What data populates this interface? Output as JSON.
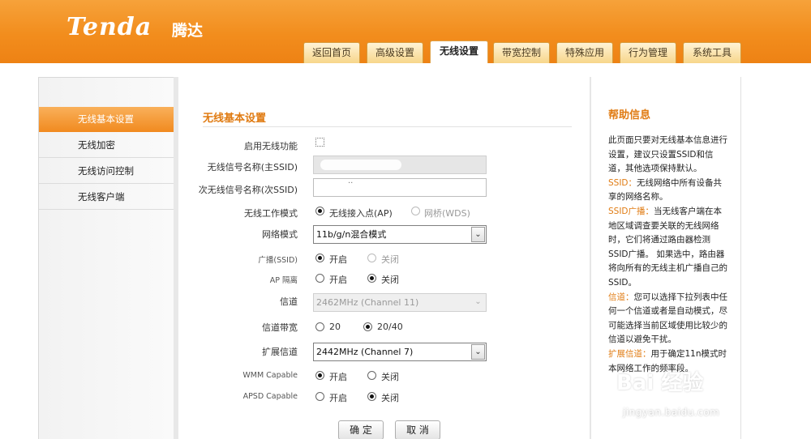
{
  "header": {
    "logo_text": "Tenda",
    "logo_cn": "腾达",
    "tabs": [
      "返回首页",
      "高级设置",
      "无线设置",
      "带宽控制",
      "特殊应用",
      "行为管理",
      "系统工具"
    ],
    "active_tab": "无线设置",
    "accent_color": "#f28d1d"
  },
  "sidebar": {
    "items": [
      "无线基本设置",
      "无线加密",
      "无线访问控制",
      "无线客户端"
    ],
    "active": "无线基本设置"
  },
  "form": {
    "title": "无线基本设置",
    "enable_wireless_label": "启用无线功能",
    "ssid_label": "无线信号名称(主SSID)",
    "ssid2_label": "次无线信号名称(次SSID)",
    "ssid2_value": "··",
    "mode_label": "无线工作模式",
    "mode_options": [
      "无线接入点(AP)",
      "网桥(WDS)"
    ],
    "network_mode_label": "网络模式",
    "network_mode_value": "11b/g/n混合模式",
    "broadcast_label": "广播(SSID)",
    "on": "开启",
    "off": "关闭",
    "ap_isolation_label": "AP 隔离",
    "channel_label": "信道",
    "channel_value": "2462MHz (Channel 11)",
    "bandwidth_label": "信道带宽",
    "bandwidth_options": [
      "20",
      "20/40"
    ],
    "ext_channel_label": "扩展信道",
    "ext_channel_value": "2442MHz (Channel 7)",
    "wmm_label": "WMM Capable",
    "apsd_label": "APSD Capable",
    "ok_button": "确 定",
    "cancel_button": "取 消"
  },
  "help": {
    "title": "帮助信息",
    "intro": "此页面只要对无线基本信息进行设置，建议只设置SSID和信道，其他选项保持默认。",
    "ssid_term": "SSID：",
    "ssid_text": "无线网络中所有设备共享的网络名称。",
    "bcast_term": "SSID广播：",
    "bcast_text": "当无线客户端在本地区域调查要关联的无线网络时，它们将通过路由器检测SSID广播。 如果选中，路由器将向所有的无线主机广播自己的SSID。",
    "channel_term": "信道：",
    "channel_text": "您可以选择下拉列表中任何一个信道或者是自动模式，尽可能选择当前区域使用比较少的信道以避免干扰。",
    "ext_term": "扩展信道：",
    "ext_text": "用于确定11n模式时本网络工作的频率段。"
  },
  "watermark": {
    "text": "Bai 经验",
    "url": "jingyan.baidu.com"
  }
}
